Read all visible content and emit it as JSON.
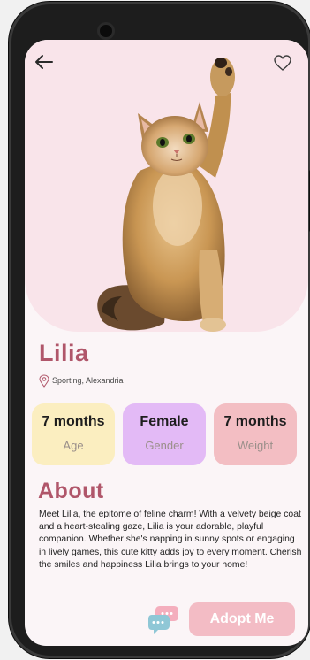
{
  "pet": {
    "name": "Lilia",
    "location": "Sporting, Alexandria"
  },
  "stats": [
    {
      "value": "7 months",
      "label": "Age"
    },
    {
      "value": "Female",
      "label": "Gender"
    },
    {
      "value": "7 months",
      "label": "Weight"
    }
  ],
  "about": {
    "title": "About",
    "text": "Meet Lilia, the epitome of feline charm!  With a velvety beige coat and a heart-stealing gaze, Lilia is your adorable, playful companion. Whether she's napping in sunny spots or engaging in lively games, this cute kitty adds joy to every moment. Cherish the smiles and happiness Lilia brings to your home!"
  },
  "actions": {
    "adopt_label": "Adopt Me"
  },
  "icons": {
    "back": "back-arrow-icon",
    "favorite": "heart-outline-icon",
    "location": "location-pin-icon",
    "chat": "chat-bubbles-icon"
  },
  "colors": {
    "accent": "#b0566a",
    "hero_bg": "#f9e4ea",
    "age_card": "#fbeec0",
    "gender_card": "#e3baf6",
    "weight_card": "#f3bec3",
    "adopt_button": "#f3bcc5"
  }
}
